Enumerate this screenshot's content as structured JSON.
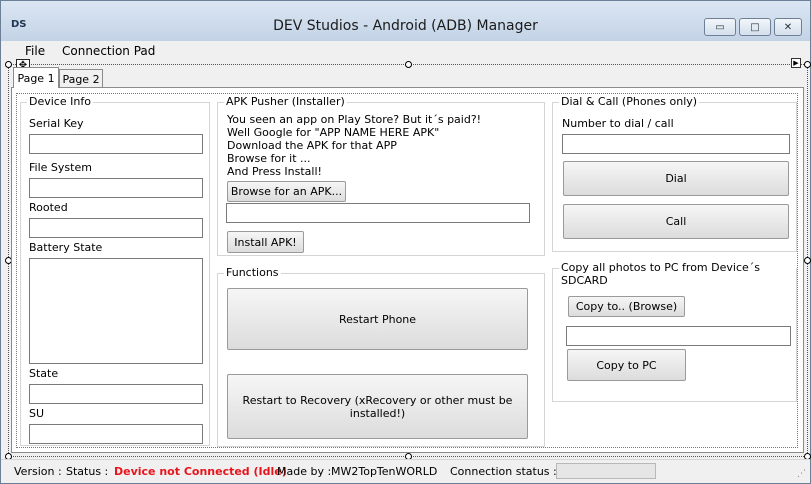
{
  "window": {
    "app_icon": "DS",
    "title": "DEV Studios - Android (ADB) Manager",
    "controls": {
      "minimize": "▭",
      "maximize": "□",
      "close": "✕"
    }
  },
  "menu": {
    "items": [
      "File",
      "Connection Pad"
    ]
  },
  "tabs": [
    {
      "label": "Page 1",
      "active": true
    },
    {
      "label": "Page 2",
      "active": false
    }
  ],
  "device_info": {
    "title": "Device Info",
    "serial_key_label": "Serial Key",
    "serial_key_value": "",
    "file_system_label": "File System",
    "file_system_value": "",
    "rooted_label": "Rooted",
    "rooted_value": "",
    "battery_state_label": "Battery State",
    "battery_state_value": "",
    "state_label": "State",
    "state_value": "",
    "su_label": "SU",
    "su_value": ""
  },
  "apk_pusher": {
    "title": "APK Pusher (Installer)",
    "instructions": [
      "You seen an app on Play Store? But it´s paid?!",
      "Well Google for \"APP NAME HERE APK\"",
      "Download the APK for that APP",
      "Browse for it ...",
      "And Press Install!"
    ],
    "browse_button": "Browse for an APK...",
    "path_value": "",
    "install_button": "Install APK!"
  },
  "functions": {
    "title": "Functions",
    "restart_phone_button": "Restart Phone",
    "restart_recovery_button": "Restart to Recovery (xRecovery or other must be installed!)"
  },
  "dial_call": {
    "title": "Dial & Call (Phones only)",
    "number_label": "Number to dial / call",
    "number_value": "",
    "dial_button": "Dial",
    "call_button": "Call"
  },
  "copy_photos": {
    "title": "Copy all photos to PC from Device´s SDCARD",
    "browse_button": "Copy to.. (Browse)",
    "path_value": "",
    "copy_button": "Copy to PC"
  },
  "status_bar": {
    "version_label": "Version :",
    "status_label": "Status :",
    "status_value": "Device not Connected (Idle)",
    "made_by_label": "Made by :",
    "made_by_value": "MW2TopTenWORLD",
    "connection_status_label": "Connection status :",
    "connection_progress": 0
  },
  "icons": {
    "move_handle": "move-icon",
    "tab_scroll": "tab-scroll-arrow-icon",
    "size_grip": "size-grip-icon"
  },
  "colors": {
    "status_error": "#e8141b",
    "window_frame": "#6d7f96"
  }
}
